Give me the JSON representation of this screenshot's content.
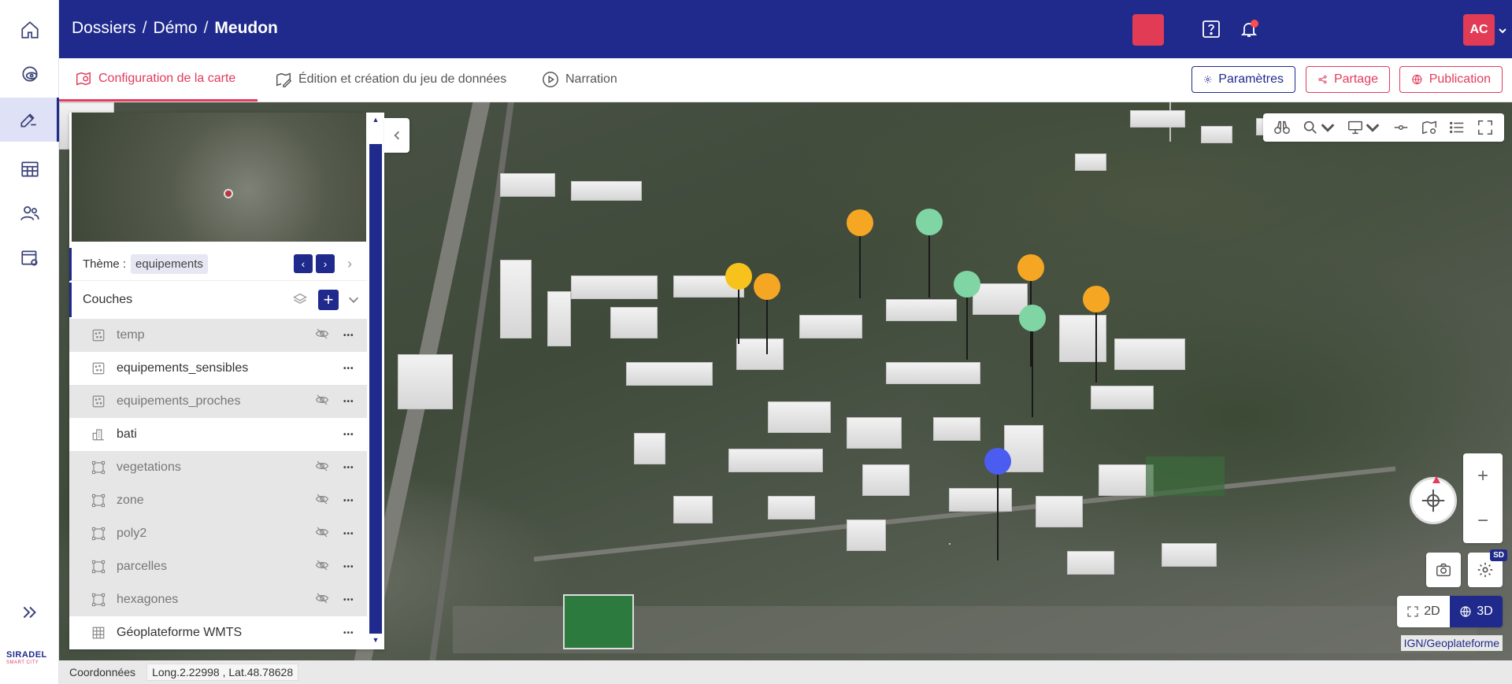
{
  "breadcrumb": {
    "items": [
      "Dossiers",
      "Démo",
      "Meudon"
    ],
    "separator": "/"
  },
  "header": {
    "help_icon": "help-icon",
    "notification_icon": "bell-icon",
    "user_initials": "AC"
  },
  "tabs": [
    {
      "label": "Configuration de la carte",
      "icon": "map-pin-icon",
      "active": true
    },
    {
      "label": "Édition et création du jeu de données",
      "icon": "edit-map-icon",
      "active": false
    },
    {
      "label": "Narration",
      "icon": "play-icon",
      "active": false
    }
  ],
  "actions": {
    "settings": "Paramètres",
    "share": "Partage",
    "publish": "Publication"
  },
  "panel": {
    "theme_label": "Thème :",
    "theme_value": "equipements",
    "layers_title": "Couches",
    "layers": [
      {
        "name": "temp",
        "icon": "point-layer-icon",
        "hidden": true
      },
      {
        "name": "equipements_sensibles",
        "icon": "point-layer-icon",
        "hidden": false
      },
      {
        "name": "equipements_proches",
        "icon": "point-layer-icon",
        "hidden": true
      },
      {
        "name": "bati",
        "icon": "building-layer-icon",
        "hidden": false
      },
      {
        "name": "vegetations",
        "icon": "polygon-layer-icon",
        "hidden": true
      },
      {
        "name": "zone",
        "icon": "polygon-layer-icon",
        "hidden": true
      },
      {
        "name": "poly2",
        "icon": "polygon-layer-icon",
        "hidden": true
      },
      {
        "name": "parcelles",
        "icon": "polygon-layer-icon",
        "hidden": true
      },
      {
        "name": "hexagones",
        "icon": "polygon-layer-icon",
        "hidden": true
      },
      {
        "name": "Géoplateforme WMTS",
        "icon": "raster-layer-icon",
        "hidden": false
      }
    ]
  },
  "map": {
    "mode_2d": "2D",
    "mode_3d": "3D",
    "active_mode": "3D",
    "sd_badge": "SD",
    "attribution": "IGN/Geoplateforme",
    "zoom_in": "+",
    "zoom_out": "−",
    "marker_colors": {
      "orange": "#f5a623",
      "yellow": "#f7c21b",
      "green": "#7fd6a4",
      "blue": "#4b5cf0"
    }
  },
  "coordinates": {
    "label": "Coordonnées",
    "value": "Long.2.22998 , Lat.48.78628"
  },
  "logo": {
    "name": "SIRADEL",
    "tagline": "SMART CITY"
  },
  "colors": {
    "brand": "#1f2a8c",
    "accent": "#e23b5c"
  }
}
